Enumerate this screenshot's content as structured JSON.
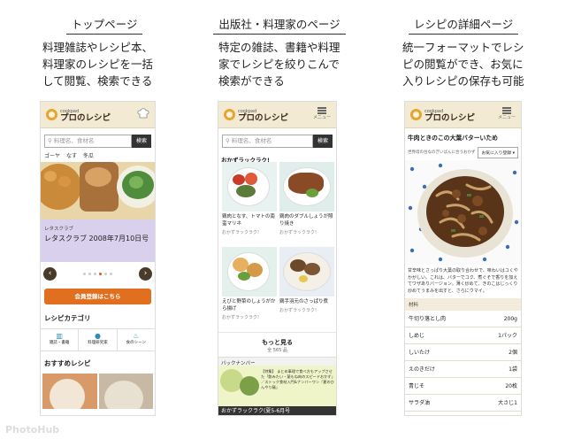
{
  "columns": [
    {
      "title": "トップページ",
      "desc": [
        "料理雑誌やレシピ本、",
        "料理家のレシピを一括",
        "して閲覧、検索できる"
      ]
    },
    {
      "title": "出版社・料理家のページ",
      "desc": [
        "特定の雑誌、書籍や料理",
        "家でレシピを絞りこんで",
        "検索ができる"
      ]
    },
    {
      "title": "レシピの詳細ページ",
      "desc": [
        "統一フォーマットでレシ",
        "ピの閲覧ができ、お気に",
        "入りレシピの保存も可能"
      ]
    }
  ],
  "app": {
    "brand_small": "cookpad",
    "brand": "プロのレシピ",
    "menu_label": "メニュー"
  },
  "phone1": {
    "search_placeholder": "料理名、食材名",
    "search_btn": "検索",
    "keywords": [
      "ゴーヤ",
      "なす",
      "冬瓜"
    ],
    "slide_small": "レタスクラブ",
    "slide_title": "レタスクラブ 2008年7月10日号",
    "register_btn": "会員登録はこちら",
    "category_heading": "レシピカテゴリ",
    "categories": [
      "雑誌・書籍",
      "料理研究家",
      "食のシーン"
    ],
    "recommend_heading": "おすすめレシピ"
  },
  "phone2": {
    "search_placeholder": "料理名、食材名",
    "search_btn": "検索",
    "section": "おかずラックラク!",
    "cards": [
      {
        "name": "鶏肉となす、トマトの南蛮マリネ",
        "sub": "おかずラックラク!"
      },
      {
        "name": "鶏肉のダブルしょうが照り焼き",
        "sub": "おかずラックラク!"
      },
      {
        "name": "えびと野菜のしょうがから揚げ",
        "sub": "おかずラックラク!"
      },
      {
        "name": "鶏手羽元のさっぱり煮",
        "sub": "おかずラックラク!"
      }
    ],
    "more": "もっと見る",
    "more_sub": "全 565 品",
    "backnumber": "バックナンバー",
    "backnumber_text": "【特集】 まとめ事理で食べ方もアップさせた「飲みたい・薬もね肉のスピードおかず」／ストック食材入門&ナンバーワン「夏のひんやり麺」",
    "backnumber_title": "おかずラックラク(夏5-6月号"
  },
  "phone3": {
    "recipe_title": "牛肉ときのこの大葉バターいため",
    "source": "世界母の台なのぎいばんに合うおかず",
    "fav_btn": "お気に入り登録 ▾",
    "body": "甘辛味とさっぱり大葉の取り合わせで、味わいはコくやかがしい。これは、バターでコク、煮ぐそで香りを加えてワザありバージョン。薄く炒めて、きのこはじっくり炒めてうまみを出すと、さらにウマイ。",
    "ing_heading": "材料",
    "ingredients": [
      {
        "name": "牛切り落とし肉",
        "qty": "200g"
      },
      {
        "name": "しめじ",
        "qty": "1パック"
      },
      {
        "name": "しいたけ",
        "qty": "2個"
      },
      {
        "name": "えのきだけ",
        "qty": "1袋"
      },
      {
        "name": "青じそ",
        "qty": "20枚"
      },
      {
        "name": "サラダ油",
        "qty": "大さじ1"
      }
    ]
  },
  "watermark": "PhotoHub"
}
